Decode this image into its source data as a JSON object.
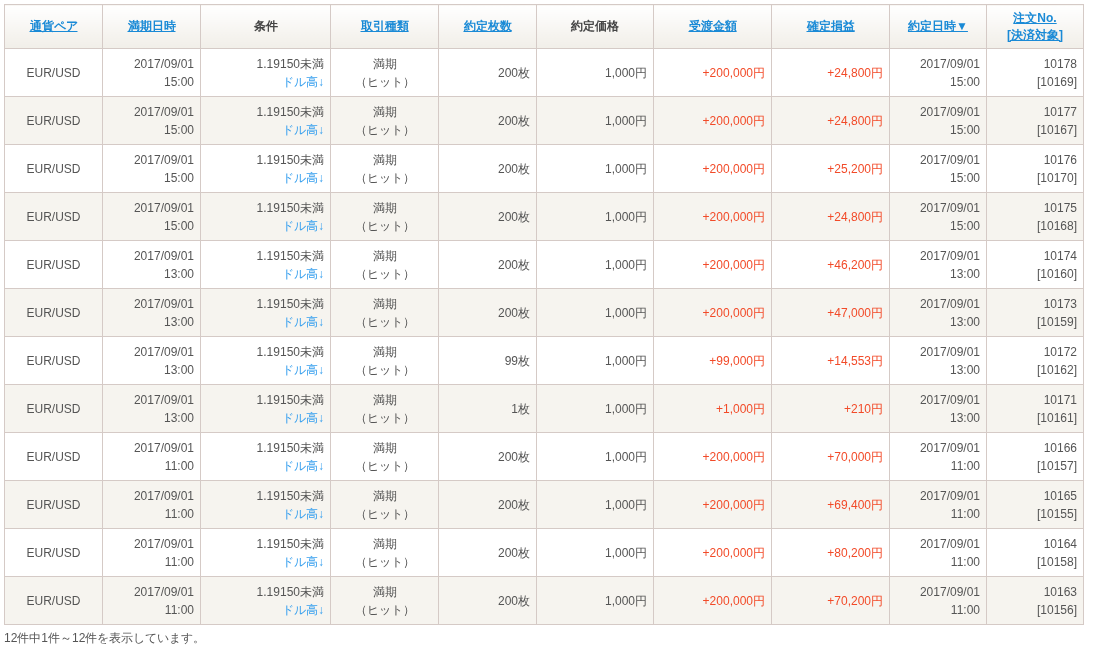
{
  "table": {
    "columns": [
      {
        "label": "通貨ペア",
        "link": true
      },
      {
        "label": "満期日時",
        "link": true
      },
      {
        "label": "条件",
        "link": false
      },
      {
        "label": "取引種類",
        "link": true
      },
      {
        "label": "約定枚数",
        "link": true
      },
      {
        "label": "約定価格",
        "link": false
      },
      {
        "label": "受渡金額",
        "link": true
      },
      {
        "label": "確定損益",
        "link": true
      },
      {
        "label": "約定日時▼",
        "link": true
      },
      {
        "label": "注文No.",
        "label_2": "[決済対象]",
        "link": true
      }
    ],
    "rows": [
      {
        "pair": "EUR/USD",
        "expiry_date": "2017/09/01",
        "expiry_time": "15:00",
        "condition": "1.19150未満",
        "direction": "ドル高↓",
        "type": "満期",
        "type_detail": "（ヒット）",
        "quantity": "200枚",
        "price": "1,000円",
        "amount": "+200,000円",
        "profit": "+24,800円",
        "exec_date": "2017/09/01",
        "exec_time": "15:00",
        "order_no": "10178",
        "settle_no": "[10169]"
      },
      {
        "pair": "EUR/USD",
        "expiry_date": "2017/09/01",
        "expiry_time": "15:00",
        "condition": "1.19150未満",
        "direction": "ドル高↓",
        "type": "満期",
        "type_detail": "（ヒット）",
        "quantity": "200枚",
        "price": "1,000円",
        "amount": "+200,000円",
        "profit": "+24,800円",
        "exec_date": "2017/09/01",
        "exec_time": "15:00",
        "order_no": "10177",
        "settle_no": "[10167]"
      },
      {
        "pair": "EUR/USD",
        "expiry_date": "2017/09/01",
        "expiry_time": "15:00",
        "condition": "1.19150未満",
        "direction": "ドル高↓",
        "type": "満期",
        "type_detail": "（ヒット）",
        "quantity": "200枚",
        "price": "1,000円",
        "amount": "+200,000円",
        "profit": "+25,200円",
        "exec_date": "2017/09/01",
        "exec_time": "15:00",
        "order_no": "10176",
        "settle_no": "[10170]"
      },
      {
        "pair": "EUR/USD",
        "expiry_date": "2017/09/01",
        "expiry_time": "15:00",
        "condition": "1.19150未満",
        "direction": "ドル高↓",
        "type": "満期",
        "type_detail": "（ヒット）",
        "quantity": "200枚",
        "price": "1,000円",
        "amount": "+200,000円",
        "profit": "+24,800円",
        "exec_date": "2017/09/01",
        "exec_time": "15:00",
        "order_no": "10175",
        "settle_no": "[10168]"
      },
      {
        "pair": "EUR/USD",
        "expiry_date": "2017/09/01",
        "expiry_time": "13:00",
        "condition": "1.19150未満",
        "direction": "ドル高↓",
        "type": "満期",
        "type_detail": "（ヒット）",
        "quantity": "200枚",
        "price": "1,000円",
        "amount": "+200,000円",
        "profit": "+46,200円",
        "exec_date": "2017/09/01",
        "exec_time": "13:00",
        "order_no": "10174",
        "settle_no": "[10160]"
      },
      {
        "pair": "EUR/USD",
        "expiry_date": "2017/09/01",
        "expiry_time": "13:00",
        "condition": "1.19150未満",
        "direction": "ドル高↓",
        "type": "満期",
        "type_detail": "（ヒット）",
        "quantity": "200枚",
        "price": "1,000円",
        "amount": "+200,000円",
        "profit": "+47,000円",
        "exec_date": "2017/09/01",
        "exec_time": "13:00",
        "order_no": "10173",
        "settle_no": "[10159]"
      },
      {
        "pair": "EUR/USD",
        "expiry_date": "2017/09/01",
        "expiry_time": "13:00",
        "condition": "1.19150未満",
        "direction": "ドル高↓",
        "type": "満期",
        "type_detail": "（ヒット）",
        "quantity": "99枚",
        "price": "1,000円",
        "amount": "+99,000円",
        "profit": "+14,553円",
        "exec_date": "2017/09/01",
        "exec_time": "13:00",
        "order_no": "10172",
        "settle_no": "[10162]"
      },
      {
        "pair": "EUR/USD",
        "expiry_date": "2017/09/01",
        "expiry_time": "13:00",
        "condition": "1.19150未満",
        "direction": "ドル高↓",
        "type": "満期",
        "type_detail": "（ヒット）",
        "quantity": "1枚",
        "price": "1,000円",
        "amount": "+1,000円",
        "profit": "+210円",
        "exec_date": "2017/09/01",
        "exec_time": "13:00",
        "order_no": "10171",
        "settle_no": "[10161]"
      },
      {
        "pair": "EUR/USD",
        "expiry_date": "2017/09/01",
        "expiry_time": "11:00",
        "condition": "1.19150未満",
        "direction": "ドル高↓",
        "type": "満期",
        "type_detail": "（ヒット）",
        "quantity": "200枚",
        "price": "1,000円",
        "amount": "+200,000円",
        "profit": "+70,000円",
        "exec_date": "2017/09/01",
        "exec_time": "11:00",
        "order_no": "10166",
        "settle_no": "[10157]"
      },
      {
        "pair": "EUR/USD",
        "expiry_date": "2017/09/01",
        "expiry_time": "11:00",
        "condition": "1.19150未満",
        "direction": "ドル高↓",
        "type": "満期",
        "type_detail": "（ヒット）",
        "quantity": "200枚",
        "price": "1,000円",
        "amount": "+200,000円",
        "profit": "+69,400円",
        "exec_date": "2017/09/01",
        "exec_time": "11:00",
        "order_no": "10165",
        "settle_no": "[10155]"
      },
      {
        "pair": "EUR/USD",
        "expiry_date": "2017/09/01",
        "expiry_time": "11:00",
        "condition": "1.19150未満",
        "direction": "ドル高↓",
        "type": "満期",
        "type_detail": "（ヒット）",
        "quantity": "200枚",
        "price": "1,000円",
        "amount": "+200,000円",
        "profit": "+80,200円",
        "exec_date": "2017/09/01",
        "exec_time": "11:00",
        "order_no": "10164",
        "settle_no": "[10158]"
      },
      {
        "pair": "EUR/USD",
        "expiry_date": "2017/09/01",
        "expiry_time": "11:00",
        "condition": "1.19150未満",
        "direction": "ドル高↓",
        "type": "満期",
        "type_detail": "（ヒット）",
        "quantity": "200枚",
        "price": "1,000円",
        "amount": "+200,000円",
        "profit": "+70,200円",
        "exec_date": "2017/09/01",
        "exec_time": "11:00",
        "order_no": "10163",
        "settle_no": "[10156]"
      }
    ]
  },
  "status_text": "12件中1件～12件を表示しています。"
}
